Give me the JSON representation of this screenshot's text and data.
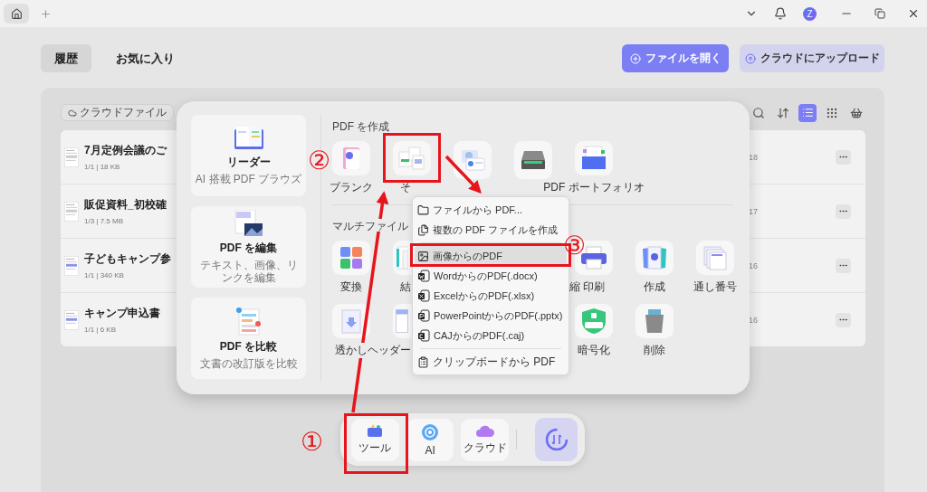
{
  "titlebar": {
    "avatar": "Z"
  },
  "nav_tabs": [
    {
      "label": "履歴",
      "selected": true
    },
    {
      "label": "お気に入り",
      "selected": false
    }
  ],
  "actions": [
    {
      "kind": "primary",
      "label": "ファイルを開く"
    },
    {
      "kind": "secondary",
      "label": "クラウドにアップロード"
    }
  ],
  "panel": {
    "cloud_chip": "クラウドファイル",
    "view_buttons": [
      {
        "kind": "search",
        "selected": false
      },
      {
        "kind": "sort",
        "selected": false
      },
      {
        "kind": "list",
        "selected": true
      },
      {
        "kind": "grid",
        "selected": false
      },
      {
        "kind": "basket",
        "selected": false
      }
    ],
    "files": [
      {
        "name": "7月定例会議のご",
        "meta": "1/1 | 18 KB",
        "column_3": "18"
      },
      {
        "name": "販促資料_初校確",
        "meta": "1/3 | 7.5 MB",
        "column_3": "17"
      },
      {
        "name": "子どもキャンプ参",
        "meta": "1/1 | 340 KB",
        "column_3": "16"
      },
      {
        "name": "キャンプ申込書",
        "meta": "1/1 | 6 KB",
        "column_3": "16"
      }
    ]
  },
  "popup": {
    "cards": [
      {
        "kind": "reader",
        "title": "リーダー",
        "subtitle": "AI 搭載 PDF ブラウズ"
      },
      {
        "kind": "edit",
        "title": "PDF を編集",
        "subtitle": "テキスト、画像、リンクを編集"
      },
      {
        "kind": "compare",
        "title": "PDF を比較",
        "subtitle": "文書の改訂版を比較"
      }
    ],
    "create_heading": "PDF を作成",
    "create_tools": [
      {
        "kind": "blank",
        "label": "ブランク"
      },
      {
        "kind": "other",
        "label": "そ"
      },
      {
        "kind": "idcard"
      },
      {
        "kind": "scanner"
      },
      {
        "kind": "portfolio",
        "label": "PDF ポートフォリオ"
      }
    ],
    "multi_heading": "マルチファイル",
    "multi_tools": [
      [
        {
          "kind": "convert",
          "label": "変換"
        },
        {
          "kind": "combine",
          "label": "結"
        },
        {
          "label": "縮"
        },
        {
          "kind": "print",
          "label": "印刷"
        },
        {
          "kind": "create",
          "label": "作成"
        },
        {
          "kind": "bates",
          "label": "通し番号"
        }
      ],
      [
        {
          "kind": "watermark",
          "label": "透かし"
        },
        {
          "kind": "header",
          "label": "ヘッダー"
        },
        {
          "kind": "encrypt",
          "label": "暗号化"
        },
        {
          "kind": "delete",
          "label": "削除"
        }
      ]
    ]
  },
  "menu": {
    "groups": [
      [
        {
          "kind": "folder",
          "label": "ファイルから PDF...",
          "selected": false
        },
        {
          "kind": "files",
          "label": "複数の PDF ファイルを作成",
          "selected": false
        }
      ],
      [
        {
          "kind": "image",
          "label": "画像からのPDF",
          "selected": true
        },
        {
          "kind": "word",
          "label": "WordからのPDF(.docx)",
          "selected": false
        },
        {
          "kind": "excel",
          "label": "ExcelからのPDF(.xlsx)",
          "selected": false
        },
        {
          "kind": "powerpoint",
          "label": "PowerPointからのPDF(.pptx)",
          "selected": false
        },
        {
          "kind": "caj",
          "label": "CAJからのPDF(.caj)",
          "selected": false
        }
      ],
      [
        {
          "kind": "clipboard",
          "label": "クリップボードから PDF",
          "selected": false
        }
      ]
    ]
  },
  "dock": [
    {
      "kind": "tools",
      "label": "ツール"
    },
    {
      "kind": "ai",
      "label": "AI"
    },
    {
      "kind": "cloud",
      "label": "クラウド"
    },
    {
      "kind": "sync"
    }
  ],
  "annotations": [
    {
      "text": "①"
    },
    {
      "text": "②"
    },
    {
      "text": "③"
    }
  ]
}
